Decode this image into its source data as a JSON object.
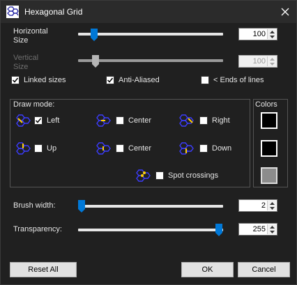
{
  "window": {
    "title": "Hexagonal Grid"
  },
  "sliders": {
    "horizontal": {
      "label": "Horizontal\nSize",
      "value": "100",
      "disabled": false
    },
    "vertical": {
      "label": "Vertical\nSize",
      "value": "100",
      "disabled": true
    },
    "brush": {
      "label": "Brush width:",
      "value": "2"
    },
    "transparency": {
      "label": "Transparency:",
      "value": "255"
    }
  },
  "options": {
    "linked": {
      "label": "Linked sizes",
      "checked": true
    },
    "antialiased": {
      "label": "Anti-Aliased",
      "checked": true
    },
    "ends": {
      "label": "< Ends of lines",
      "checked": false
    }
  },
  "drawmode": {
    "title": "Draw mode:",
    "items": [
      {
        "label": "Left",
        "checked": true
      },
      {
        "label": "Center",
        "checked": false
      },
      {
        "label": "Right",
        "checked": false
      },
      {
        "label": "Up",
        "checked": false
      },
      {
        "label": "Center",
        "checked": false
      },
      {
        "label": "Down",
        "checked": false
      },
      {
        "label": "Spot crossings",
        "checked": false
      }
    ]
  },
  "colors": {
    "title": "Colors",
    "swatches": [
      "#000000",
      "#000000",
      "#8c8c8c"
    ]
  },
  "buttons": {
    "reset": "Reset All",
    "ok": "OK",
    "cancel": "Cancel"
  }
}
